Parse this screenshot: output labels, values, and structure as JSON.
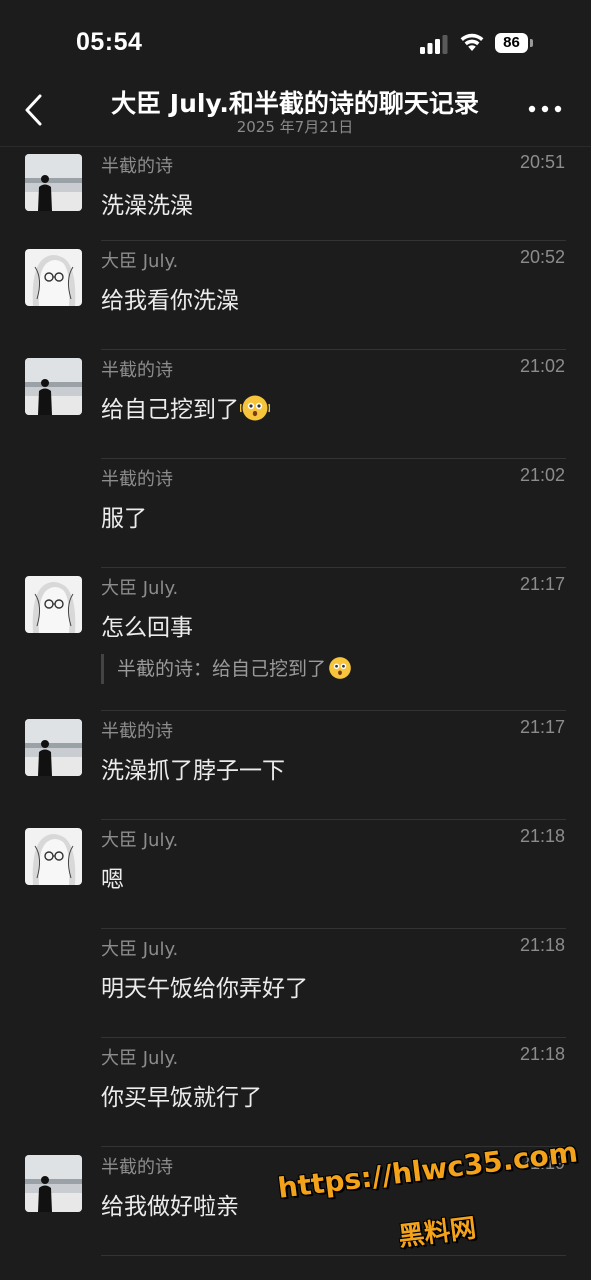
{
  "status_bar": {
    "time": "05:54",
    "battery": "86"
  },
  "header": {
    "title": "大臣 July.和半截的诗的聊天记录",
    "subtitle": "2025 年7月21日"
  },
  "messages": [
    {
      "sender": "半截的诗",
      "time": "20:51",
      "text": "洗澡洗澡",
      "avatar": "man-by-sea"
    },
    {
      "sender": "大臣 July.",
      "time": "20:52",
      "text": "给我看你洗澡",
      "avatar": "anime-girl"
    },
    {
      "sender": "半截的诗",
      "time": "21:02",
      "text": "给自己挖到了",
      "emoji": "shaking-face-emoji",
      "avatar": "man-by-sea"
    },
    {
      "sender": "半截的诗",
      "time": "21:02",
      "text": "服了"
    },
    {
      "sender": "大臣 July.",
      "time": "21:17",
      "text": "怎么回事",
      "avatar": "anime-girl",
      "quote": {
        "text": "半截的诗：给自己挖到了",
        "emoji": "shaking-face-emoji"
      }
    },
    {
      "sender": "半截的诗",
      "time": "21:17",
      "text": "洗澡抓了脖子一下",
      "avatar": "man-by-sea"
    },
    {
      "sender": "大臣 July.",
      "time": "21:18",
      "text": "嗯",
      "avatar": "anime-girl"
    },
    {
      "sender": "大臣 July.",
      "time": "21:18",
      "text": "明天午饭给你弄好了"
    },
    {
      "sender": "大臣 July.",
      "time": "21:18",
      "text": "你买早饭就行了"
    },
    {
      "sender": "半截的诗",
      "time": "21:19",
      "text": "给我做好啦亲",
      "avatar": "man-by-sea"
    }
  ],
  "watermark": {
    "url": "https://hlwc35.com",
    "label": "黑料网"
  },
  "colors": {
    "background": "#1c1c1c",
    "text": "#ececec",
    "muted": "#8c8c8c",
    "watermark": "#f5a21b"
  }
}
